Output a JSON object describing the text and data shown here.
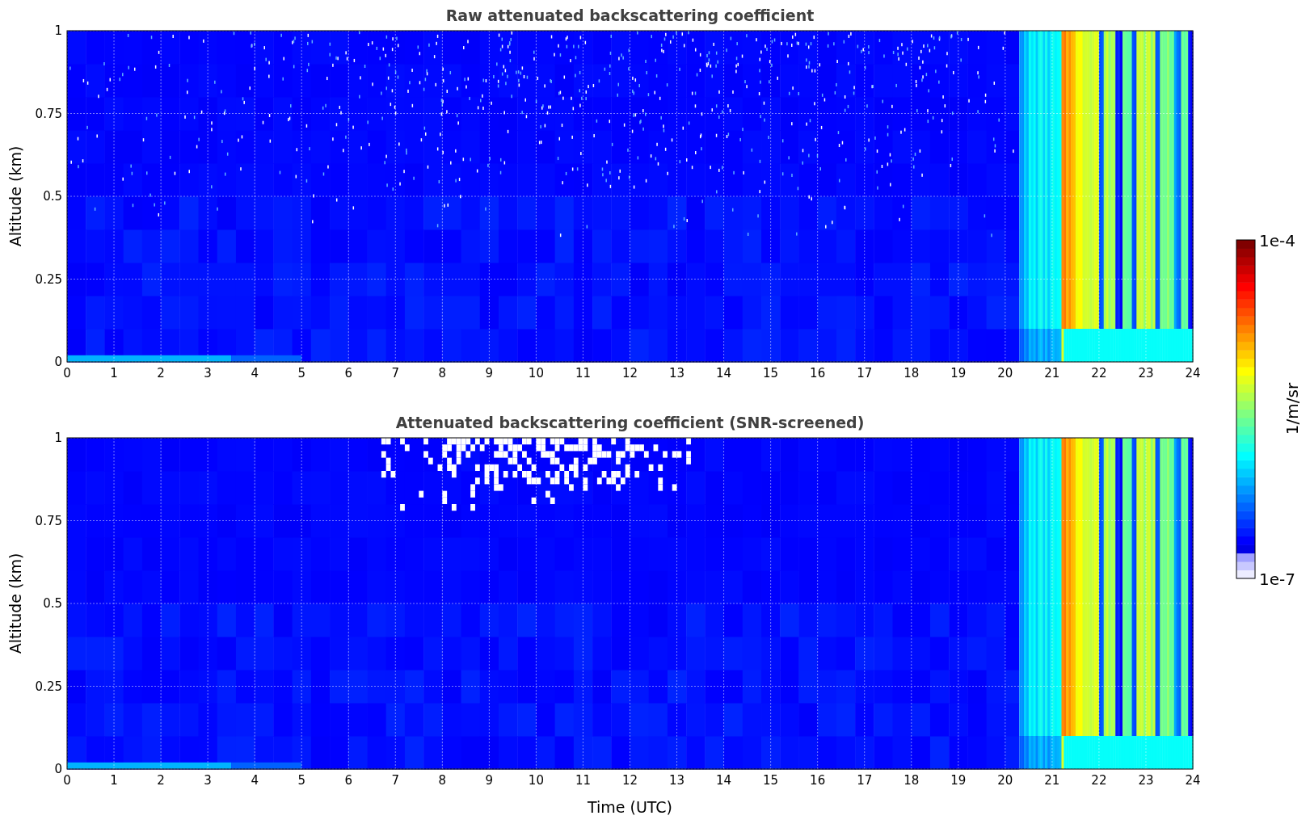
{
  "panels": [
    {
      "kind": "raw",
      "title": "Raw attenuated backscattering coefficient",
      "ylabel": "Altitude (km)",
      "yticks": [
        "1",
        "0.75",
        "0.5",
        "0.25",
        "0"
      ],
      "xticks": [
        "0",
        "1",
        "2",
        "3",
        "4",
        "5",
        "6",
        "7",
        "8",
        "9",
        "10",
        "11",
        "12",
        "13",
        "14",
        "15",
        "16",
        "17",
        "18",
        "19",
        "20",
        "21",
        "22",
        "23",
        "24"
      ]
    },
    {
      "kind": "screened",
      "title": "Attenuated backscattering coefficient (SNR-screened)",
      "ylabel": "Altitude (km)",
      "yticks": [
        "1",
        "0.75",
        "0.5",
        "0.25",
        "0"
      ],
      "xticks": [
        "0",
        "1",
        "2",
        "3",
        "4",
        "5",
        "6",
        "7",
        "8",
        "9",
        "10",
        "11",
        "12",
        "13",
        "14",
        "15",
        "16",
        "17",
        "18",
        "19",
        "20",
        "21",
        "22",
        "23",
        "24"
      ]
    }
  ],
  "xlabel": "Time (UTC)",
  "colorbar": {
    "label": "1/m/sr",
    "max": "1e-4",
    "min": "1e-7"
  }
}
